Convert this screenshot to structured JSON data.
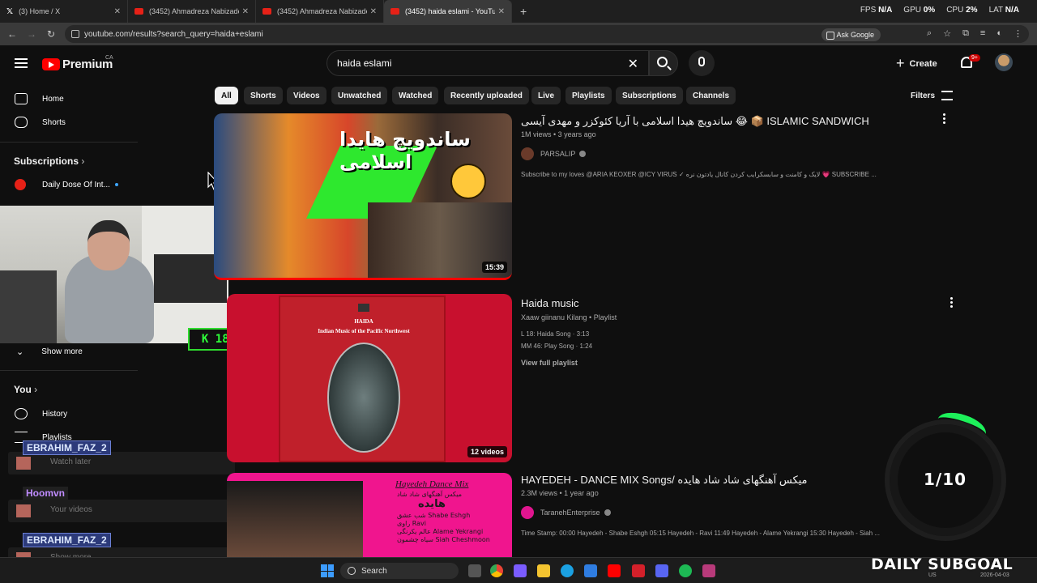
{
  "browser": {
    "tabs": [
      {
        "label": "(3) Home / X",
        "icon": "x-logo-icon"
      },
      {
        "label": "(3452) Ahmadreza Nabizadeh -",
        "icon": "youtube-icon"
      },
      {
        "label": "(3452) Ahmadreza Nabizadeh -",
        "icon": "youtube-icon"
      },
      {
        "label": "(3452) haida eslami - YouTube",
        "icon": "youtube-icon",
        "active": true
      }
    ],
    "new_tab": "+",
    "stats": {
      "fps_label": "FPS",
      "fps": "N/A",
      "gpu_label": "GPU",
      "gpu": "0%",
      "cpu_label": "CPU",
      "cpu": "2%",
      "lat_label": "LAT",
      "lat": "N/A"
    },
    "url": "youtube.com/results?search_query=haida+eslami",
    "ask_google": "Ask Google"
  },
  "youtube": {
    "brand": "Premium",
    "country": "CA",
    "search_value": "haida eslami",
    "create_label": "Create",
    "notif_badge": "9+"
  },
  "sidebar": {
    "home": "Home",
    "shorts": "Shorts",
    "subscriptions_header": "Subscriptions",
    "sub_channel": "Daily Dose Of Int...",
    "show_more": "Show more",
    "you_header": "You",
    "history": "History",
    "playlists": "Playlists"
  },
  "overlay": {
    "kbadge": "K 185",
    "chat": [
      {
        "name": "EBRAHIM_FAZ_2",
        "ghost": "Watch later"
      },
      {
        "name": "Hoomvn",
        "ghost": "Your videos"
      },
      {
        "name": "EBRAHIM_FAZ_2",
        "ghost": "Show more"
      }
    ],
    "goal_count": "1/10",
    "subgoal": "DAILY SUBGOAL"
  },
  "chips": [
    "All",
    "Shorts",
    "Videos",
    "Unwatched",
    "Watched",
    "Recently uploaded",
    "Live",
    "Playlists",
    "Subscriptions",
    "Channels"
  ],
  "filters_label": "Filters",
  "results": [
    {
      "title": "ساندویچ هیدا اسلامی با آریا کئوکزر و مهدی آیسی 😂 📦 ISLAMIC SANDWICH",
      "meta": "1M views • 3 years ago",
      "channel": "PARSALIP",
      "desc": "Subscribe to my loves @ARIA KEOXER @ICY VIRUS ✓ لایک و کامنت و سابسکرایب کردن کانال یادتون نره 💗 SUBSCRIBE ...",
      "duration": "15:39",
      "thumb_text": "ساندویچ هایدا اسلامی"
    },
    {
      "title": "Haida music",
      "meta": "Xaaw giinanu Kilang • Playlist",
      "line1": "L 18: Haida Song · 3:13",
      "line2": "MM 46: Play Song · 1:24",
      "link": "View full playlist",
      "count": "12 videos",
      "cover_title": "HAIDA",
      "cover_subtitle": "Indian Music of the Pacific Northwest"
    },
    {
      "title": "HAYEDEH - DANCE MIX Songs/ میکس آهنگهای شاد شاد هایده",
      "meta": "2.3M views • 1 year ago",
      "channel": "TaranehEnterprise",
      "desc": "Time Stamp: 00:00 Hayedeh - Shabe Eshgh 05:15 Hayedeh - Ravi 11:49 Hayedeh - Alame Yekrangi 15:30 Hayedeh - Siah ...",
      "thumb_title": "Hayedeh Dance Mix",
      "thumb_sub": "میکس آهنگهای شاد شاد",
      "thumb_big": "هایده",
      "thumb_list": [
        "شب عشق  Shabe Eshgh",
        "راوی  Ravi",
        "عالم یکرنگی  Alame Yekrangi",
        "سیاه چشمون  Siah Cheshmoon"
      ]
    }
  ],
  "taskbar": {
    "search": "Search",
    "region": "US",
    "date": "2026-04-03"
  }
}
